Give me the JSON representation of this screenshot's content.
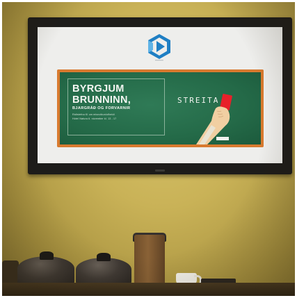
{
  "screen": {
    "headline_line1": "BYRGJUM",
    "headline_line2": "BRUNNINN,",
    "subheadline": "BJARGRÁÐ OG FORVARNIR",
    "detail_line1": "Ráðstefna KI um misnotkun/ofbeldi",
    "detail_line2": "Hótel Natura 6. nóvember kl. 13 - 17",
    "chalk_word": "STREITA"
  },
  "colors": {
    "wall": "#c9b257",
    "board_green": "#246a48",
    "board_frame": "#d87a2f",
    "logo_blue": "#1f7fc4",
    "card_red": "#e8202a"
  }
}
